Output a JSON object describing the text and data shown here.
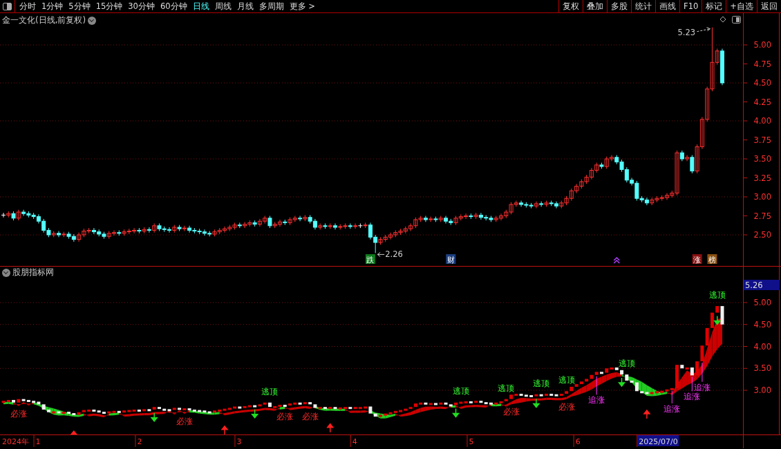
{
  "toolbar": {
    "periods": [
      {
        "label": "分时",
        "selected": false
      },
      {
        "label": "1分钟",
        "selected": false
      },
      {
        "label": "5分钟",
        "selected": false
      },
      {
        "label": "15分钟",
        "selected": false
      },
      {
        "label": "30分钟",
        "selected": false
      },
      {
        "label": "60分钟",
        "selected": false
      },
      {
        "label": "日线",
        "selected": true
      },
      {
        "label": "周线",
        "selected": false
      },
      {
        "label": "月线",
        "selected": false
      },
      {
        "label": "多周期",
        "selected": false
      },
      {
        "label": "更多 >",
        "selected": false
      }
    ],
    "buttons": [
      "复权",
      "叠加",
      "多股",
      "统计",
      "画线",
      "F10",
      "标记",
      "+自选",
      "返回"
    ]
  },
  "main": {
    "title": "金一文化(日线,前复权)",
    "axis_labels": [
      "5.00",
      "4.75",
      "4.50",
      "4.25",
      "4.00",
      "3.75",
      "3.50",
      "3.25",
      "3.00",
      "2.75",
      "2.50"
    ],
    "price_labels": [
      {
        "kind": "high",
        "label": "5.23"
      },
      {
        "kind": "low",
        "label": "2.26"
      }
    ],
    "events": [
      {
        "kind": "badge",
        "label": "跌",
        "color": "#0e7a1e"
      },
      {
        "kind": "badge",
        "label": "财",
        "color": "#1d3f80"
      },
      {
        "kind": "caret"
      },
      {
        "kind": "badge",
        "label": "涨",
        "color": "#8a1010"
      },
      {
        "kind": "badge",
        "label": "榜",
        "color": "#8a5010"
      }
    ]
  },
  "indicator": {
    "title": "股朋指标网",
    "cursor_value": "5.26",
    "axis_labels": [
      "5.00",
      "4.50",
      "4.00",
      "3.50",
      "3.00"
    ],
    "signals": [
      {
        "kind": "buy",
        "label": "必涨"
      },
      {
        "kind": "triangle"
      },
      {
        "kind": "down-arrow"
      },
      {
        "kind": "buy",
        "label": "必涨"
      },
      {
        "kind": "up-arrow"
      },
      {
        "kind": "down-arrow"
      },
      {
        "kind": "top",
        "label": "逃顶"
      },
      {
        "kind": "buy",
        "label": "必涨"
      },
      {
        "kind": "buy",
        "label": "必涨"
      },
      {
        "kind": "up-arrow"
      },
      {
        "kind": "down-arrow"
      },
      {
        "kind": "top",
        "label": "逃顶"
      },
      {
        "kind": "top",
        "label": "逃顶"
      },
      {
        "kind": "buy",
        "label": "必涨"
      },
      {
        "kind": "down-arrow"
      },
      {
        "kind": "top",
        "label": "逃顶"
      },
      {
        "kind": "top",
        "label": "逃顶"
      },
      {
        "kind": "buy",
        "label": "必涨"
      },
      {
        "kind": "chase",
        "label": "追涨"
      },
      {
        "kind": "down-arrow"
      },
      {
        "kind": "top",
        "label": "逃顶"
      },
      {
        "kind": "up-arrow"
      },
      {
        "kind": "chase",
        "label": "追涨"
      },
      {
        "kind": "chase",
        "label": "追涨"
      },
      {
        "kind": "chase",
        "label": "追涨"
      },
      {
        "kind": "down-arrow"
      },
      {
        "kind": "top",
        "label": "逃顶"
      }
    ]
  },
  "time_axis": [
    {
      "label": "2024年",
      "selected": false
    },
    {
      "label": "1",
      "selected": false
    },
    {
      "label": "2",
      "selected": false
    },
    {
      "label": "3",
      "selected": false
    },
    {
      "label": "4",
      "selected": false
    },
    {
      "label": "5",
      "selected": false
    },
    {
      "label": "6",
      "selected": false
    },
    {
      "label": "2025/07/0",
      "selected": true
    }
  ]
}
